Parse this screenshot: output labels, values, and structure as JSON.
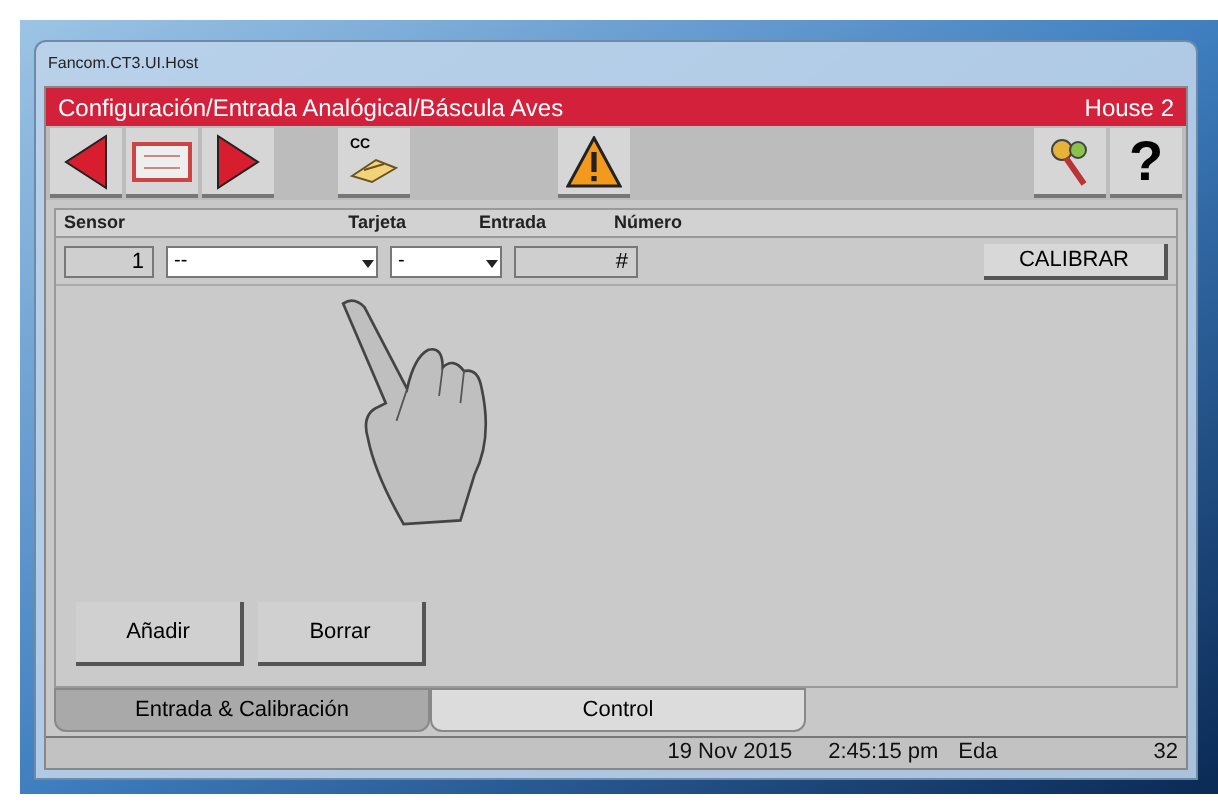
{
  "window": {
    "title": "Fancom.CT3.UI.Host"
  },
  "header": {
    "path": "Configuración/Entrada Analógical/Báscula Aves",
    "house": "House 2"
  },
  "toolbar": {
    "cc_label": "CC",
    "help_label": "?"
  },
  "table": {
    "columns": [
      "Sensor",
      "Tarjeta",
      "Entrada",
      "Número"
    ],
    "rows": [
      {
        "sensor": "1",
        "tarjeta": "--",
        "entrada": "-",
        "numero": "#",
        "action": "CALIBRAR"
      }
    ]
  },
  "buttons": [
    "Añadir",
    "Borrar"
  ],
  "tabs": [
    {
      "label": "Entrada & Calibración",
      "selected": true
    },
    {
      "label": "Control",
      "selected": false
    }
  ],
  "status_bar": {
    "date": "19 Nov 2015",
    "time": "2:45:15 pm",
    "user": "Eda",
    "number": "32"
  }
}
